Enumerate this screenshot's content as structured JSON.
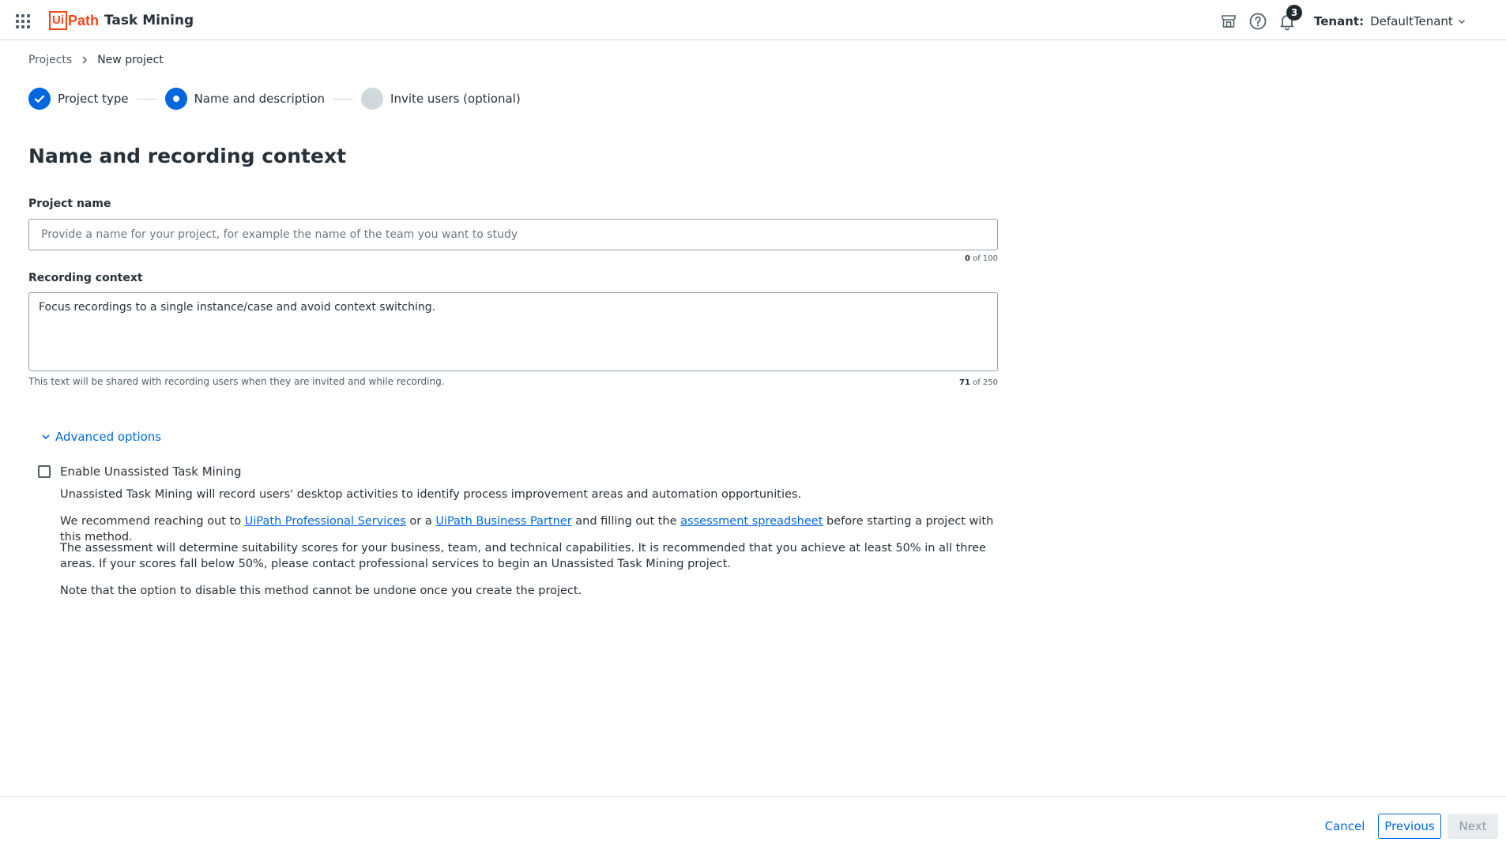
{
  "header": {
    "logo_text": "Ui",
    "logo_word": "Path",
    "product_name": "Task Mining",
    "notification_count": "3",
    "tenant_label": "Tenant:",
    "tenant_value": "DefaultTenant"
  },
  "breadcrumb": {
    "items": [
      "Projects",
      "New project"
    ]
  },
  "stepper": {
    "steps": [
      {
        "label": "Project type",
        "state": "done"
      },
      {
        "label": "Name and description",
        "state": "active"
      },
      {
        "label": "Invite users (optional)",
        "state": "todo"
      }
    ]
  },
  "page": {
    "title": "Name and recording context"
  },
  "form": {
    "project_name": {
      "label": "Project name",
      "value": "",
      "placeholder": "Provide a name for your project, for example the name of the team you want to study",
      "count": "0",
      "count_suffix": " of 100"
    },
    "recording_context": {
      "label": "Recording context",
      "value": "Focus recordings to a single instance/case and avoid context switching.",
      "helper": "This text will be shared with recording users when they are invited and while recording.",
      "count": "71",
      "count_suffix": " of 250"
    }
  },
  "advanced": {
    "toggle_label": "Advanced options",
    "checkbox_label": "Enable Unassisted Task Mining",
    "checkbox_checked": false,
    "para1": "Unassisted Task Mining will record users' desktop activities to identify process improvement areas and automation opportunities.",
    "para2": {
      "t1": "We recommend reaching out to ",
      "link1": "UiPath Professional Services",
      "t2": " or a ",
      "link2": "UiPath Business Partner",
      "t3": " and filling out the ",
      "link3": "assessment spreadsheet",
      "t4": " before starting a project with this method."
    },
    "para3": "The assessment will determine suitability scores for your business, team, and technical capabilities. It is recommended that you achieve at least 50% in all three areas. If your scores fall below 50%, please contact professional services to begin an Unassisted Task Mining project.",
    "para4": "Note that the option to disable this method cannot be undone once you create the project."
  },
  "footer": {
    "cancel_label": "Cancel",
    "previous_label": "Previous",
    "next_label": "Next"
  },
  "colors": {
    "accent": "#0067df",
    "brand": "#fa4616"
  }
}
